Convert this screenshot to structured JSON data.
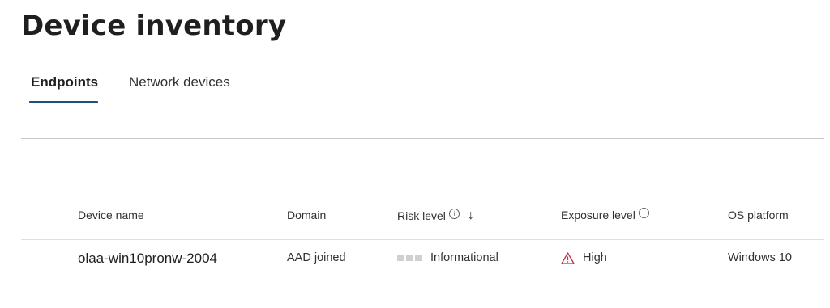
{
  "page": {
    "title": "Device inventory"
  },
  "tabs": [
    {
      "label": "Endpoints",
      "active": true
    },
    {
      "label": "Network devices",
      "active": false
    }
  ],
  "table": {
    "columns": [
      {
        "label": "Device name"
      },
      {
        "label": "Domain"
      },
      {
        "label": "Risk level",
        "info": true,
        "sort": "descending",
        "sort_icon": "arrow-down-icon"
      },
      {
        "label": "Exposure level",
        "info": true
      },
      {
        "label": "OS platform"
      }
    ],
    "rows": [
      {
        "device_name": "olaa-win10pronw-2004",
        "domain": "AAD joined",
        "risk_level": "Informational",
        "exposure_level": "High",
        "exposure_icon": "warning-triangle-icon",
        "os_platform": "Windows 10"
      }
    ]
  },
  "colors": {
    "tab_underline": "#1f4e79",
    "warning_icon": "#c4314b",
    "risk_bar": "#d2d0ce"
  }
}
